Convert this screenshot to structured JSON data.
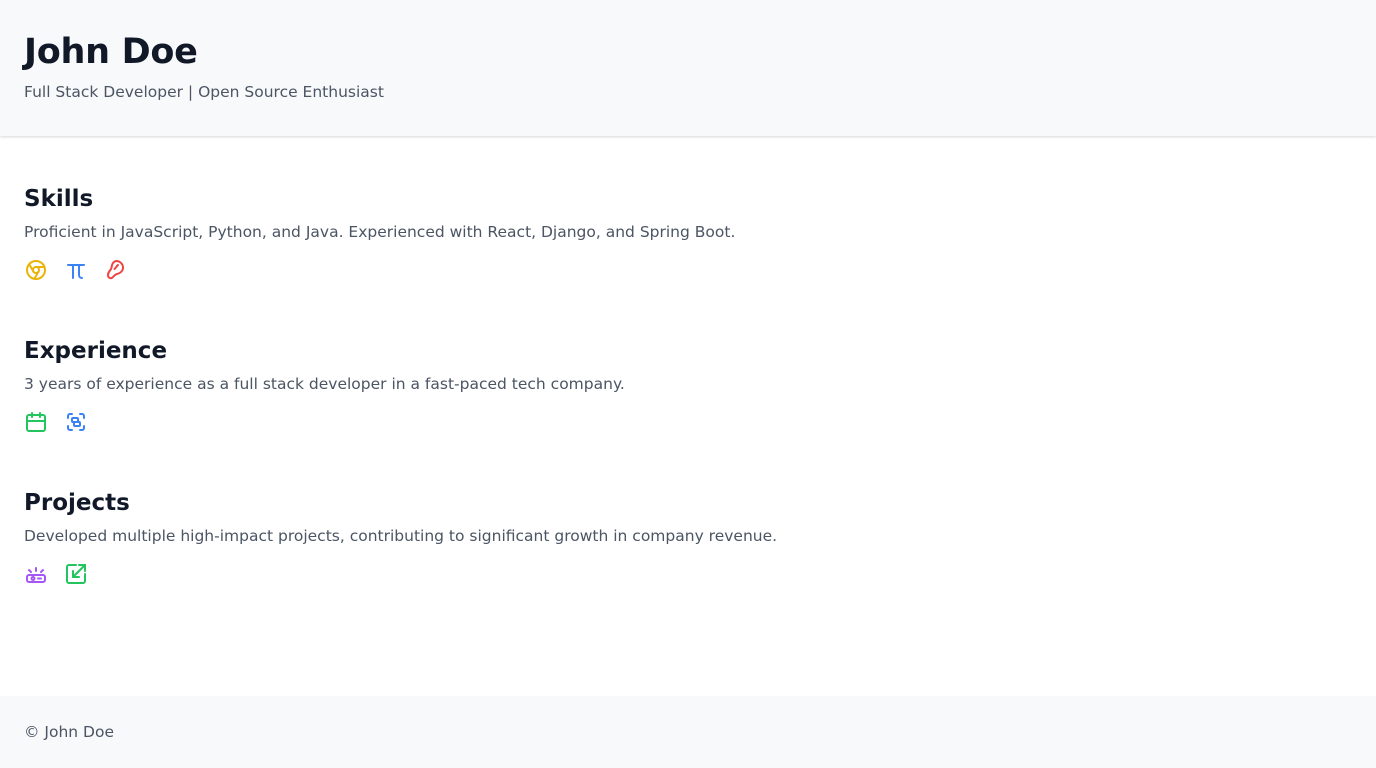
{
  "header": {
    "name": "John Doe",
    "subtitle": "Full Stack Developer | Open Source Enthusiast"
  },
  "sections": [
    {
      "title": "Skills",
      "text": "Proficient in JavaScript, Python, and Java. Experienced with React, Django, and Spring Boot.",
      "icons": [
        {
          "name": "chrome-icon",
          "color": "#eab308"
        },
        {
          "name": "pi-icon",
          "color": "#3b82f6"
        },
        {
          "name": "bean-icon",
          "color": "#ef4444"
        }
      ]
    },
    {
      "title": "Experience",
      "text": "3 years of experience as a full stack developer in a fast-paced tech company.",
      "icons": [
        {
          "name": "calendar-icon",
          "color": "#22c55e"
        },
        {
          "name": "focus-centered-icon",
          "color": "#3b82f6"
        }
      ]
    },
    {
      "title": "Projects",
      "text": "Developed multiple high-impact projects, contributing to significant growth in company revenue.",
      "icons": [
        {
          "name": "brightness-box-icon",
          "color": "#a855f7"
        },
        {
          "name": "external-link-icon",
          "color": "#22c55e"
        }
      ]
    }
  ],
  "footer": {
    "text": "© John Doe"
  }
}
